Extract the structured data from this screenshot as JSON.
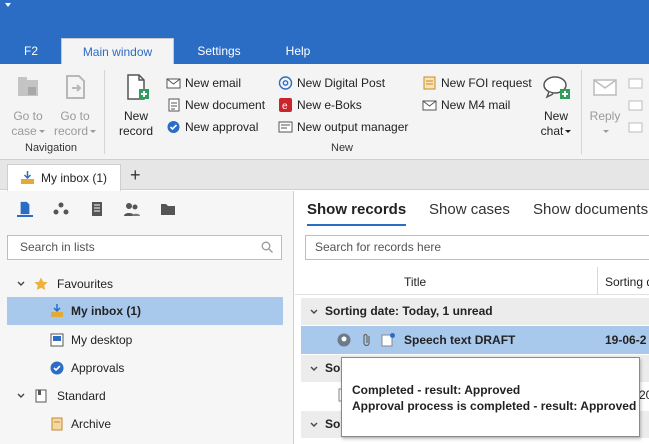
{
  "ribbon_tabs": {
    "f2": "F2",
    "main": "Main window",
    "settings": "Settings",
    "help": "Help"
  },
  "ribbon": {
    "goto_case": {
      "line1": "Go to",
      "line2": "case"
    },
    "goto_record": {
      "line1": "Go to",
      "line2": "record"
    },
    "new_record": {
      "line1": "New",
      "line2": "record"
    },
    "new_email": "New email",
    "new_document": "New document",
    "new_approval": "New approval",
    "new_digital_post": "New Digital Post",
    "new_eboks": "New e-Boks",
    "new_output_manager": "New output manager",
    "new_foi_request": "New FOI request",
    "new_m4_mail": "New M4 mail",
    "new_chat": {
      "line1": "New",
      "line2": "chat"
    },
    "reply": "Reply",
    "groups": {
      "navigation": "Navigation",
      "new": "New"
    }
  },
  "doc_tabs": {
    "inbox": "My inbox (1)",
    "add": "+"
  },
  "left": {
    "search_placeholder": "Search in lists",
    "tree": {
      "favourites": "Favourites",
      "my_inbox": "My inbox (1)",
      "my_desktop": "My desktop",
      "approvals": "Approvals",
      "standard": "Standard",
      "archive": "Archive"
    }
  },
  "right": {
    "tabs": {
      "records": "Show records",
      "cases": "Show cases",
      "documents": "Show documents"
    },
    "search_placeholder": "Search for records here",
    "columns": {
      "title": "Title",
      "sorting": "Sorting date"
    },
    "groups": {
      "today": "Sorting date: Today, 1 unread",
      "g2": "So",
      "g3": "So"
    },
    "record": {
      "title": "Speech text DRAFT",
      "date": "19-06-2"
    },
    "row2_date": "20"
  },
  "tooltip": {
    "line1": "Completed - result: Approved",
    "line2": "Approval process is completed - result: Approved"
  },
  "colors": {
    "brand": "#2b6cc4",
    "selection": "#a9c9ec",
    "ribbon_bg": "#f4f4f4"
  }
}
